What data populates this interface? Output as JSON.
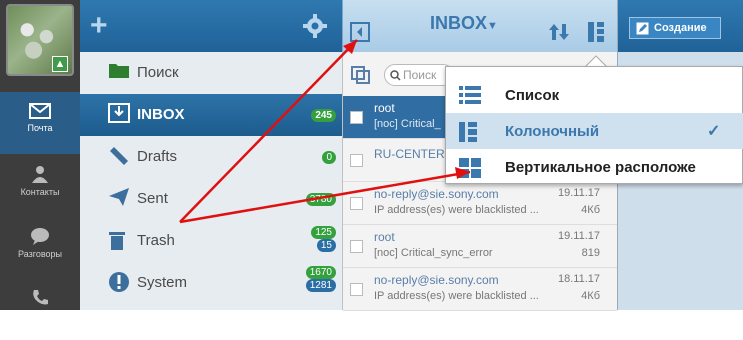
{
  "rail": {
    "items": [
      {
        "label": "Почта",
        "icon": "mail-icon"
      },
      {
        "label": "Контакты",
        "icon": "person-icon"
      },
      {
        "label": "Разговоры",
        "icon": "chat-icon"
      },
      {
        "label": "",
        "icon": "phone-icon"
      }
    ]
  },
  "folders": [
    {
      "label": "Поиск",
      "badge": null
    },
    {
      "label": "INBOX",
      "badge": "245"
    },
    {
      "label": "Drafts",
      "badge": "0"
    },
    {
      "label": "Sent",
      "badge": "3780"
    },
    {
      "label": "Trash",
      "badge": "125",
      "badge2": "15"
    },
    {
      "label": "System",
      "badge": "1670",
      "badge2": "1281"
    }
  ],
  "inbox": {
    "title": "INBOX",
    "search_placeholder": "Поиск",
    "messages": [
      {
        "from": "root",
        "subject": "[noc] Critical_",
        "date": "",
        "size": ""
      },
      {
        "from": "RU-CENTER",
        "subject": "",
        "date": "",
        "size": ""
      },
      {
        "from": "no-reply@sie.sony.com",
        "subject": "IP address(es) were blacklisted ...",
        "date": "19.11.17",
        "size": "4Кб"
      },
      {
        "from": "root",
        "subject": "[noc] Critical_sync_error",
        "date": "19.11.17",
        "size": "819"
      },
      {
        "from": "no-reply@sie.sony.com",
        "subject": "IP address(es) were blacklisted ...",
        "date": "18.11.17",
        "size": "4Кб"
      }
    ]
  },
  "toolbar": {
    "create_label": "Создание"
  },
  "view_menu": {
    "items": [
      {
        "label": "Список",
        "icon": "list-icon",
        "selected": false
      },
      {
        "label": "Колоночный",
        "icon": "columns-icon",
        "selected": true,
        "check": "✓"
      },
      {
        "label": "Вертикальное расположе",
        "icon": "vertical-layout-icon",
        "selected": false
      }
    ]
  },
  "colors": {
    "accent": "#2a6ea6",
    "badge": "#34a03e",
    "annotation": "#e01010"
  }
}
